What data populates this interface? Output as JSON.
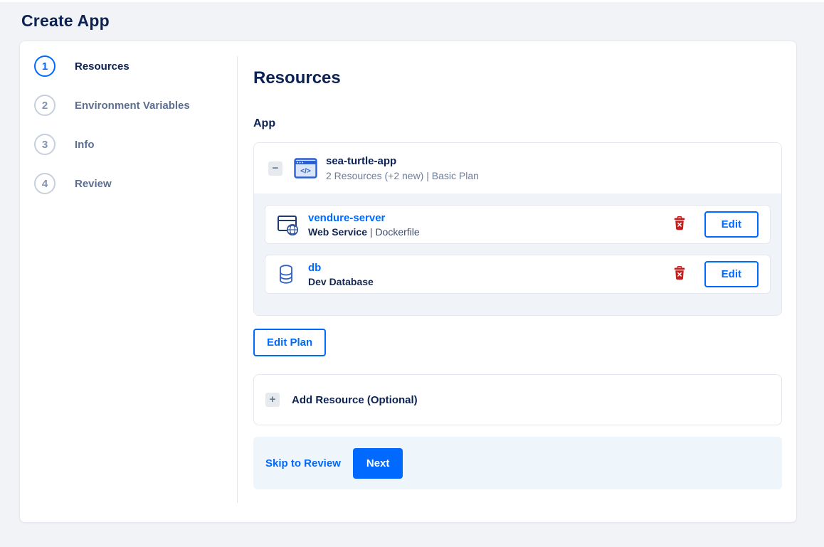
{
  "page": {
    "title": "Create App"
  },
  "sidebar": {
    "steps": [
      {
        "number": "1",
        "label": "Resources"
      },
      {
        "number": "2",
        "label": "Environment Variables"
      },
      {
        "number": "3",
        "label": "Info"
      },
      {
        "number": "4",
        "label": "Review"
      }
    ],
    "active_step": 1
  },
  "main": {
    "heading": "Resources",
    "section_label": "App",
    "app": {
      "name": "sea-turtle-app",
      "summary": "2 Resources (+2 new) | Basic Plan",
      "icon": "app-window-code-icon",
      "resources": [
        {
          "name": "vendure-server",
          "type": "Web Service",
          "separator": " | ",
          "detail": "Dockerfile",
          "icon": "web-service-globe-icon",
          "delete_icon": "trash-icon",
          "edit_label": "Edit"
        },
        {
          "name": "db",
          "type": "Dev Database",
          "separator": "",
          "detail": "",
          "icon": "database-icon",
          "delete_icon": "trash-icon",
          "edit_label": "Edit"
        }
      ]
    },
    "edit_plan_label": "Edit Plan",
    "add_resource": {
      "label": "Add Resource (Optional)",
      "icon": "plus-icon"
    },
    "footer": {
      "skip_label": "Skip to Review",
      "next_label": "Next"
    }
  },
  "colors": {
    "accent_blue": "#0069ff",
    "heading_navy": "#0b2253",
    "muted_text": "#6b7b99",
    "danger_red": "#c41f1f",
    "resource_section_bg": "#f0f3f8",
    "footer_bg": "#eef5fb",
    "page_bg": "#f1f3f6"
  }
}
